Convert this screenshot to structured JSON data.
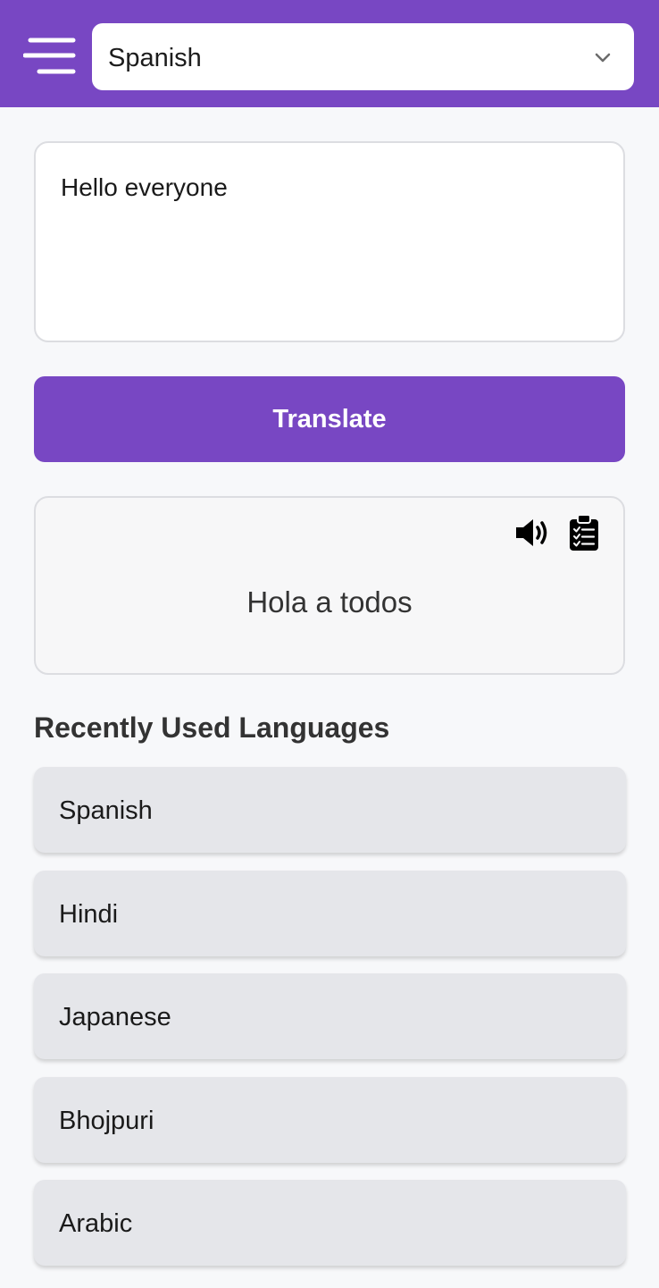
{
  "header": {
    "menu_icon": "menu-icon",
    "language_select": {
      "value": "Spanish",
      "icon": "chevron-down-icon"
    }
  },
  "input": {
    "value": "Hello everyone"
  },
  "translate_button": {
    "label": "Translate"
  },
  "result": {
    "text": "Hola a todos",
    "speak_icon": "speaker-icon",
    "copy_icon": "clipboard-icon"
  },
  "recent": {
    "title": "Recently Used Languages",
    "items": [
      {
        "label": "Spanish"
      },
      {
        "label": "Hindi"
      },
      {
        "label": "Japanese"
      },
      {
        "label": "Bhojpuri"
      },
      {
        "label": "Arabic"
      }
    ]
  },
  "colors": {
    "brand": "#7847c3",
    "background": "#f7f8fa",
    "list_item": "#e5e6ea"
  }
}
